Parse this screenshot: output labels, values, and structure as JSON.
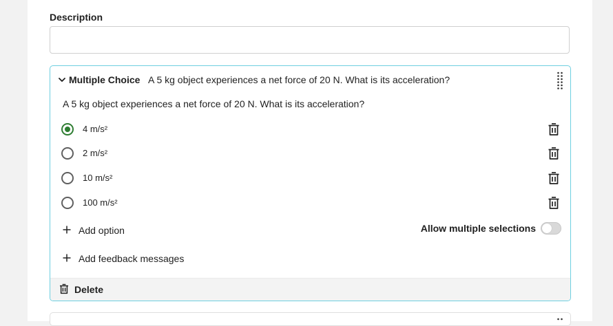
{
  "description": {
    "label": "Description",
    "value": "",
    "placeholder": ""
  },
  "question": {
    "type_label": "Multiple Choice",
    "title": "A 5 kg object experiences a net force of 20 N. What is its acceleration?",
    "text": "A 5 kg object experiences a net force of 20 N. What is its acceleration?",
    "options": [
      {
        "label": "4 m/s²",
        "selected": true
      },
      {
        "label": "2 m/s²",
        "selected": false
      },
      {
        "label": "10 m/s²",
        "selected": false
      },
      {
        "label": "100 m/s²",
        "selected": false
      }
    ],
    "add_option_label": "Add option",
    "allow_multiple_label": "Allow multiple selections",
    "allow_multiple": false,
    "add_feedback_label": "Add feedback messages",
    "delete_label": "Delete"
  },
  "colors": {
    "accent_border": "#6dcfe0",
    "selected_radio": "#2e7d32",
    "footer_bg": "#f3f3f3"
  },
  "icons": {
    "collapse": "chevron-down-icon",
    "drag": "drag-handle-icon",
    "trash": "trash-icon",
    "add": "plus-icon"
  }
}
